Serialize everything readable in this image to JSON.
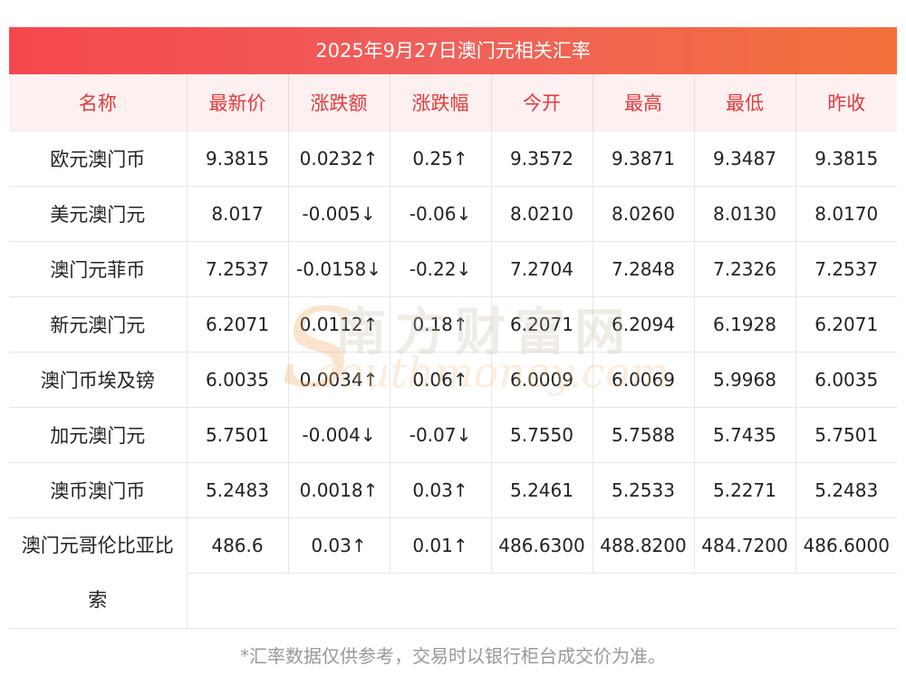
{
  "title": "2025年9月27日澳门元相关汇率",
  "headers": [
    "名称",
    "最新价",
    "涨跌额",
    "涨跌幅",
    "今开",
    "最高",
    "最低",
    "昨收"
  ],
  "rows": [
    {
      "name": "欧元澳门币",
      "latest": "9.3815",
      "change": "0.0232↑",
      "pct": "0.25↑",
      "open": "9.3572",
      "high": "9.3871",
      "low": "9.3487",
      "prev": "9.3815",
      "dir": "up"
    },
    {
      "name": "美元澳门元",
      "latest": "8.017",
      "change": "-0.005↓",
      "pct": "-0.06↓",
      "open": "8.0210",
      "high": "8.0260",
      "low": "8.0130",
      "prev": "8.0170",
      "dir": "down"
    },
    {
      "name": "澳门元菲币",
      "latest": "7.2537",
      "change": "-0.0158↓",
      "pct": "-0.22↓",
      "open": "7.2704",
      "high": "7.2848",
      "low": "7.2326",
      "prev": "7.2537",
      "dir": "down"
    },
    {
      "name": "新元澳门元",
      "latest": "6.2071",
      "change": "0.0112↑",
      "pct": "0.18↑",
      "open": "6.2071",
      "high": "6.2094",
      "low": "6.1928",
      "prev": "6.2071",
      "dir": "up"
    },
    {
      "name": "澳门币埃及镑",
      "latest": "6.0035",
      "change": "0.0034↑",
      "pct": "0.06↑",
      "open": "6.0009",
      "high": "6.0069",
      "low": "5.9968",
      "prev": "6.0035",
      "dir": "up"
    },
    {
      "name": "加元澳门元",
      "latest": "5.7501",
      "change": "-0.004↓",
      "pct": "-0.07↓",
      "open": "5.7550",
      "high": "5.7588",
      "low": "5.7435",
      "prev": "5.7501",
      "dir": "down"
    },
    {
      "name": "澳币澳门币",
      "latest": "5.2483",
      "change": "0.0018↑",
      "pct": "0.03↑",
      "open": "5.2461",
      "high": "5.2533",
      "low": "5.2271",
      "prev": "5.2483",
      "dir": "up"
    },
    {
      "name_line1": "澳门元哥伦比亚比",
      "name_line2": "索",
      "latest": "486.6",
      "change": "0.03↑",
      "pct": "0.01↑",
      "open": "486.6300",
      "high": "488.8200",
      "low": "484.7200",
      "prev": "486.6000",
      "dir": "up"
    }
  ],
  "footer": "*汇率数据仅供参考，交易时以银行柜台成交价为准。",
  "watermark": {
    "cn": "南方财富网",
    "en": "southmoney.com",
    "letter": "S"
  },
  "colors": {
    "up": "#e3160f",
    "down": "#1f8c1f",
    "header_text": "#e33b3b",
    "title_bg": "#f5474e"
  }
}
